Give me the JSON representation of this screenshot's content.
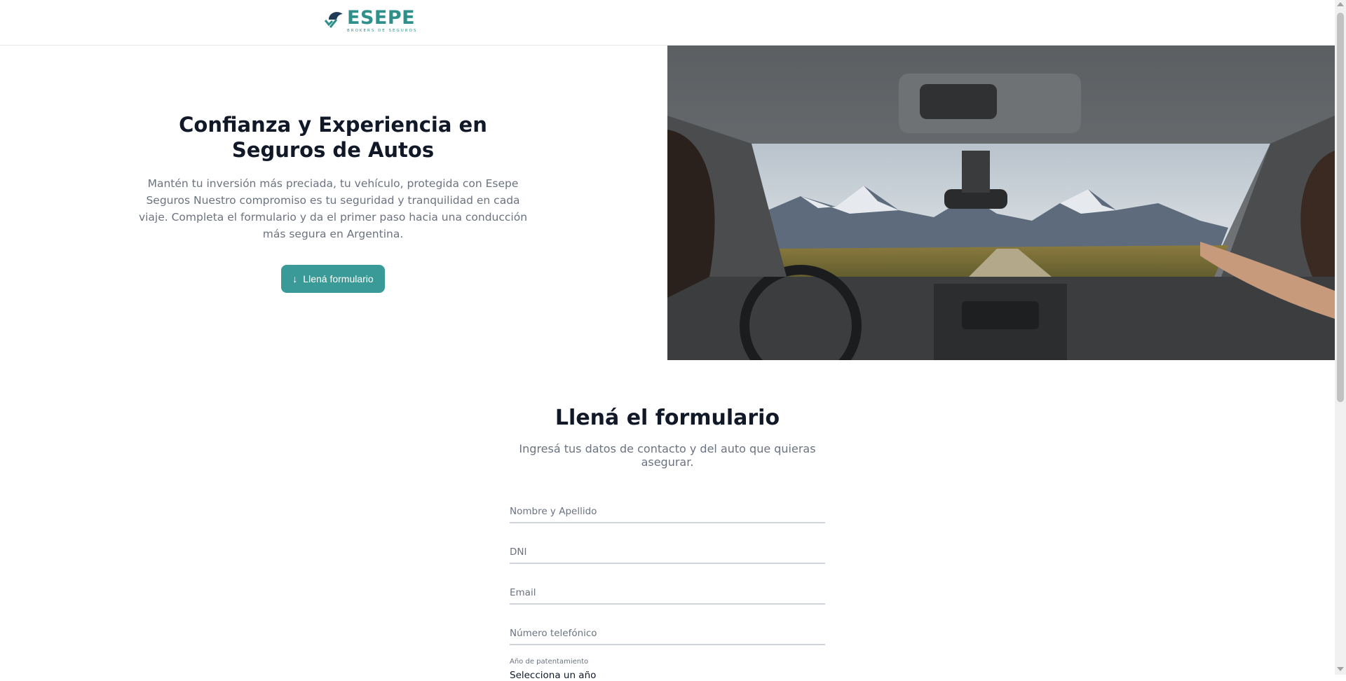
{
  "header": {
    "brand": "ESEPE",
    "brand_tagline": "BROKERS DE SEGUROS"
  },
  "hero": {
    "title": "Confianza y Experiencia en Seguros de Autos",
    "description": "Mantén tu inversión más preciada, tu vehículo, protegida con Esepe Seguros Nuestro compromiso es tu seguridad y tranquilidad en cada viaje. Completa el formulario y da el primer paso hacia una conducción más segura en Argentina.",
    "cta_label": "Llená formulario",
    "cta_icon": "arrow-down-icon"
  },
  "form": {
    "title": "Llená el formulario",
    "subtitle": "Ingresá tus datos de contacto y del auto que quieras asegurar.",
    "fields": {
      "name_placeholder": "Nombre y Apellido",
      "dni_placeholder": "DNI",
      "email_placeholder": "Email",
      "phone_placeholder": "Número telefónico"
    },
    "year": {
      "label": "Año de patentamiento",
      "selected": "Selecciona un año"
    }
  },
  "colors": {
    "accent": "#3a9a98",
    "brand": "#2f8f8b",
    "brand_dark": "#1f3b57"
  }
}
